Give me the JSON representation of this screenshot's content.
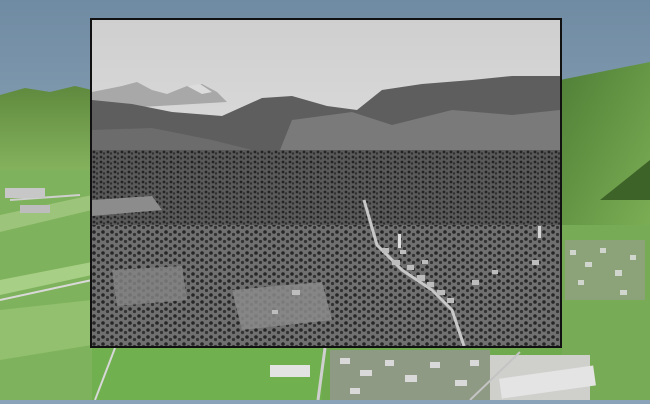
{
  "scene": {
    "background": "aerial-3d-terrain-view",
    "overlay": "historical-black-and-white-aerial-photograph",
    "colors": {
      "sky": "#8aa4ba",
      "grass": "#6fa552",
      "field": "#7fb861",
      "road": "#c9c9c9",
      "frame": "#111111"
    }
  }
}
